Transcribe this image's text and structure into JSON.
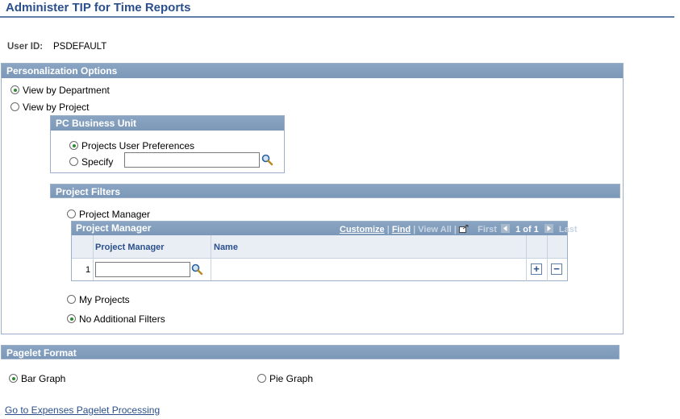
{
  "page": {
    "title": "Administer TIP for Time Reports",
    "user_id_label": "User ID:",
    "user_id_value": "PSDEFAULT"
  },
  "personalization": {
    "header": "Personalization Options",
    "view_by_department": {
      "label": "View by Department",
      "checked": true
    },
    "view_by_project": {
      "label": "View by Project",
      "checked": false
    }
  },
  "pc_business_unit": {
    "header": "PC Business Unit",
    "projects_user_prefs": {
      "label": "Projects User Preferences",
      "checked": true
    },
    "specify": {
      "label": "Specify",
      "checked": false,
      "value": ""
    }
  },
  "project_filters": {
    "header": "Project Filters",
    "project_manager_option": {
      "label": "Project Manager",
      "checked": false
    },
    "my_projects": {
      "label": "My Projects",
      "checked": false
    },
    "no_additional_filters": {
      "label": "No Additional Filters",
      "checked": true
    }
  },
  "pm_grid": {
    "title": "Project Manager",
    "customize": "Customize",
    "find": "Find",
    "view_all": "View All",
    "first": "First",
    "page_info": "1 of 1",
    "last": "Last",
    "columns": [
      "Project Manager",
      "Name"
    ],
    "rows": [
      {
        "num": "1",
        "project_manager": "",
        "name": ""
      }
    ],
    "add_symbol": "+",
    "delete_symbol": "−"
  },
  "pagelet_format": {
    "header": "Pagelet Format",
    "bar_graph": {
      "label": "Bar Graph",
      "checked": true
    },
    "pie_graph": {
      "label": "Pie Graph",
      "checked": false
    }
  },
  "footer": {
    "link": "Go to Expenses Pagelet Processing"
  }
}
